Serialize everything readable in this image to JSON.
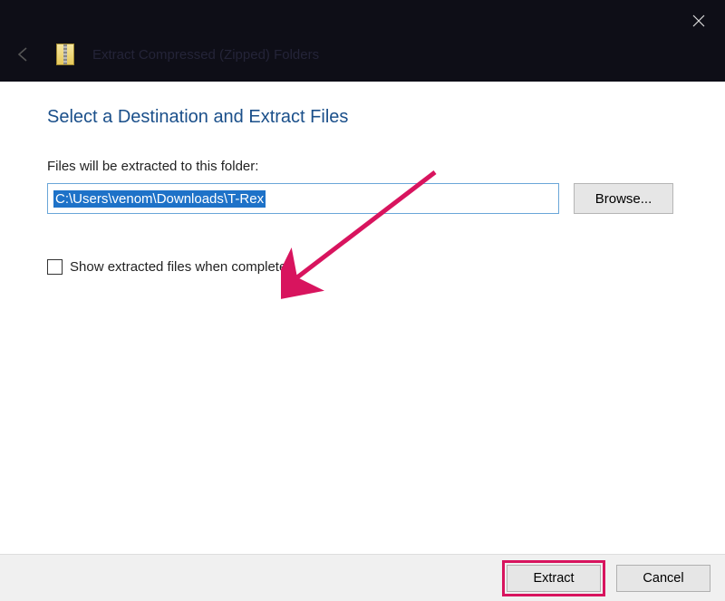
{
  "titlebar": {
    "title": "Extract Compressed (Zipped) Folders"
  },
  "dialog": {
    "heading": "Select a Destination and Extract Files",
    "field_label": "Files will be extracted to this folder:",
    "path_value": "C:\\Users\\venom\\Downloads\\T-Rex",
    "browse_label": "Browse...",
    "checkbox_label": "Show extracted files when complete",
    "checkbox_checked": false
  },
  "footer": {
    "extract_label": "Extract",
    "cancel_label": "Cancel"
  },
  "annotation": {
    "arrow_color": "#d8145e"
  }
}
